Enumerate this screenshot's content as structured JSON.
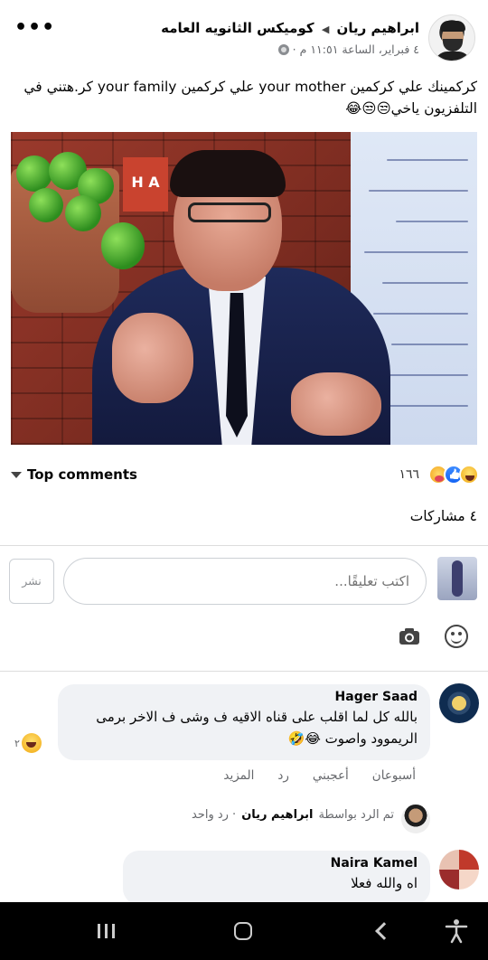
{
  "post": {
    "author": "ابراهيم ريان",
    "group": "كوميكس الثانويه العامه",
    "date": "٤ فبراير، الساعة ١١:٥١ م ·",
    "text": "كركمينك علي كركمين your mother علي كركمين your family كر.هتني في التلفزيون ياخي😒😒😂",
    "image_sign": "H A"
  },
  "engagement": {
    "top_comments_label": "Top comments",
    "reaction_count": "١٦٦",
    "shares": "٤ مشاركات"
  },
  "composer": {
    "placeholder": "اكتب تعليقًا...",
    "post_label": "نشر"
  },
  "comments": [
    {
      "name": "Hager Saad",
      "text": "بالله كل لما اقلب على قناه الاقيه ف وشى ف الاخر برمى الريموود واصوت 😂🤣",
      "reaction_count": "٢",
      "actions": [
        "أسبوعان",
        "أعجبني",
        "رد",
        "المزيد"
      ],
      "reply_summary": {
        "prefix": "تم الرد بواسطة",
        "replier": "ابراهيم ريان",
        "suffix": "· رد واحد"
      }
    },
    {
      "name": "Naira Kamel",
      "text": "اه والله فعلا"
    }
  ],
  "colors": {
    "bubble": "#f0f2f5",
    "meta_text": "#65676b",
    "like_blue": "#1464f4"
  }
}
